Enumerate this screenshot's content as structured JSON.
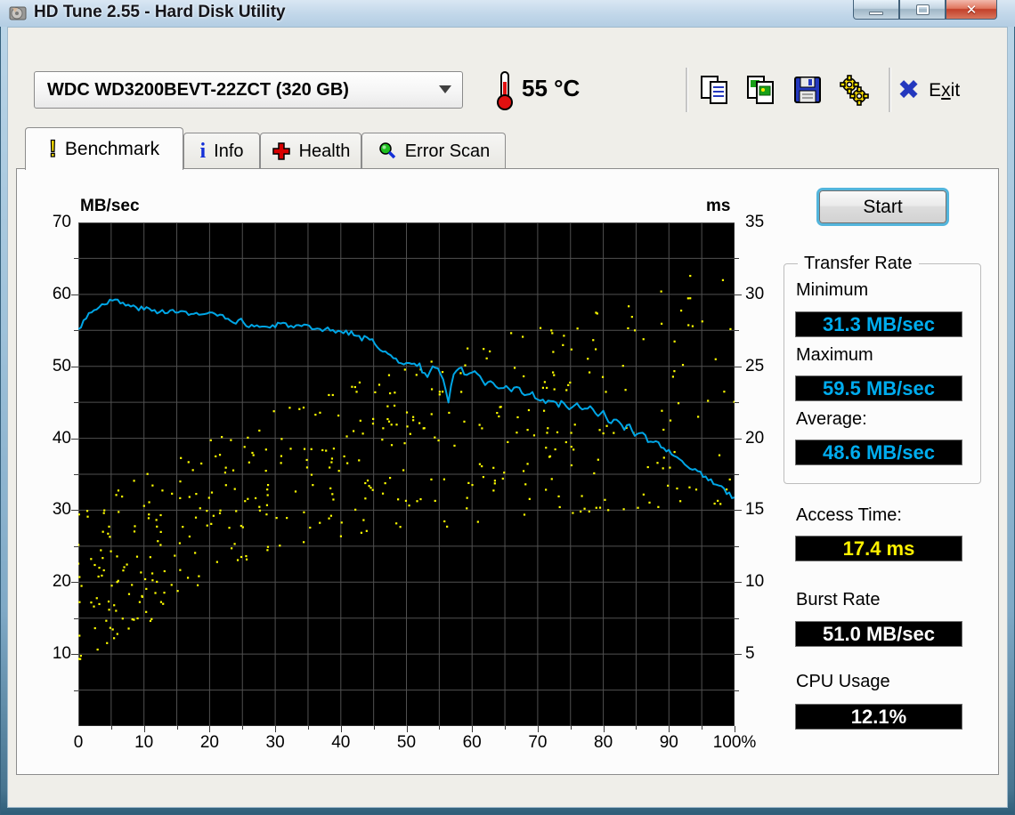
{
  "window": {
    "title": "HD Tune 2.55 - Hard Disk Utility",
    "app_icon": "hard-disk-icon",
    "controls": {
      "minimize": "minimize-button",
      "maximize": "maximize-button",
      "close": "close-button"
    }
  },
  "toolbar": {
    "drive_select": {
      "value": "WDC WD3200BEVT-22ZCT (320 GB)",
      "icon": "chevron-down-icon"
    },
    "temperature": {
      "icon": "thermometer-icon",
      "value": "55 °C"
    },
    "buttons": [
      {
        "name": "copy-text-button",
        "icon": "copy-text-icon"
      },
      {
        "name": "copy-image-button",
        "icon": "copy-image-icon"
      },
      {
        "name": "save-button",
        "icon": "save-floppy-icon"
      },
      {
        "name": "options-button",
        "icon": "gears-icon"
      }
    ],
    "exit": {
      "icon": "exit-x-icon",
      "label_pre": "E",
      "label_key": "x",
      "label_post": "it"
    }
  },
  "tabs": [
    {
      "label": "Benchmark",
      "icon": "benchmark-exclamation-icon",
      "active": true
    },
    {
      "label": "Info",
      "icon": "info-icon",
      "active": false
    },
    {
      "label": "Health",
      "icon": "health-cross-icon",
      "active": false
    },
    {
      "label": "Error Scan",
      "icon": "error-scan-magnifier-icon",
      "active": false
    }
  ],
  "benchmark": {
    "start_button": "Start",
    "transfer_rate": {
      "legend": "Transfer Rate",
      "minimum_label": "Minimum",
      "minimum_value": "31.3 MB/sec",
      "maximum_label": "Maximum",
      "maximum_value": "59.5 MB/sec",
      "average_label": "Average:",
      "average_value": "48.6 MB/sec"
    },
    "access_time_label": "Access Time:",
    "access_time_value": "17.4 ms",
    "burst_rate_label": "Burst Rate",
    "burst_rate_value": "51.0 MB/sec",
    "cpu_usage_label": "CPU Usage",
    "cpu_usage_value": "12.1%"
  },
  "colors": {
    "chart_bg": "#000000",
    "grid": "#505050",
    "line": "#00A6E6",
    "dots": "#FFFF00",
    "value_cyan": "#00ACEE",
    "value_yellow": "#FFF200",
    "value_white": "#FFFFFF"
  },
  "chart_data": {
    "type": "line",
    "title": "",
    "xlabel_ticks": [
      "0",
      "10",
      "20",
      "30",
      "40",
      "50",
      "60",
      "70",
      "80",
      "90",
      "100%"
    ],
    "x_axis": {
      "min": 0,
      "max": 100,
      "ticks": [
        0,
        10,
        20,
        30,
        40,
        50,
        60,
        70,
        80,
        90,
        100
      ],
      "minor_step": 5
    },
    "y_left": {
      "label": "MB/sec",
      "min": 0,
      "max": 70,
      "ticks": [
        70,
        60,
        50,
        40,
        30,
        20,
        10
      ],
      "minor_step": 5
    },
    "y_right": {
      "label": "ms",
      "min": 0,
      "max": 35,
      "ticks": [
        35,
        30,
        25,
        20,
        15,
        10,
        5
      ],
      "minor_step": 2.5
    },
    "grid": true,
    "legend_position": "none",
    "series": [
      {
        "name": "Transfer Rate (MB/sec)",
        "type": "line",
        "axis": "left",
        "keypoints": [
          [
            0,
            55
          ],
          [
            1,
            56.8
          ],
          [
            2,
            57.5
          ],
          [
            3,
            58.3
          ],
          [
            4,
            58.8
          ],
          [
            5,
            59.2
          ],
          [
            6,
            59
          ],
          [
            8,
            58.3
          ],
          [
            10,
            58
          ],
          [
            12,
            57.6
          ],
          [
            14,
            57.8
          ],
          [
            15,
            57.3
          ],
          [
            16,
            57.6
          ],
          [
            18,
            57.2
          ],
          [
            20,
            57.3
          ],
          [
            22,
            57
          ],
          [
            23,
            56.1
          ],
          [
            24,
            55.8
          ],
          [
            25,
            56.6
          ],
          [
            26,
            55.4
          ],
          [
            27,
            55.7
          ],
          [
            29,
            55.4
          ],
          [
            31,
            55.9
          ],
          [
            33,
            55.6
          ],
          [
            35,
            55.4
          ],
          [
            36,
            54.9
          ],
          [
            38,
            55.1
          ],
          [
            40,
            54.8
          ],
          [
            42,
            54.6
          ],
          [
            43,
            53.8
          ],
          [
            44,
            54.3
          ],
          [
            45,
            53.2
          ],
          [
            46,
            52.6
          ],
          [
            47,
            51.8
          ],
          [
            48,
            51
          ],
          [
            50,
            50.4
          ],
          [
            52,
            50.1
          ],
          [
            53,
            48.4
          ],
          [
            54,
            50
          ],
          [
            55,
            49.6
          ],
          [
            56,
            47
          ],
          [
            56.5,
            44.5
          ],
          [
            57,
            48.8
          ],
          [
            58,
            49.8
          ],
          [
            59,
            49
          ],
          [
            60,
            49.4
          ],
          [
            61,
            48.6
          ],
          [
            62,
            47.7
          ],
          [
            63,
            48.2
          ],
          [
            64,
            47
          ],
          [
            65,
            47.4
          ],
          [
            66,
            46.6
          ],
          [
            67,
            46.9
          ],
          [
            68,
            46.1
          ],
          [
            69,
            46.4
          ],
          [
            70,
            45.6
          ],
          [
            71,
            44.9
          ],
          [
            72,
            45.4
          ],
          [
            73,
            44.6
          ],
          [
            74,
            45
          ],
          [
            75,
            44.2
          ],
          [
            76,
            44.6
          ],
          [
            77,
            43.8
          ],
          [
            78,
            44.2
          ],
          [
            79,
            43.2
          ],
          [
            80,
            43.5
          ],
          [
            81,
            42.2
          ],
          [
            82,
            42.8
          ],
          [
            83,
            41.3
          ],
          [
            84,
            41.8
          ],
          [
            85,
            40.2
          ],
          [
            86,
            40.8
          ],
          [
            87,
            39.2
          ],
          [
            88,
            39.7
          ],
          [
            89,
            38.6
          ],
          [
            90,
            38.2
          ],
          [
            91,
            37.2
          ],
          [
            92,
            36.6
          ],
          [
            93,
            36.2
          ],
          [
            94,
            35.6
          ],
          [
            95,
            34.9
          ],
          [
            96,
            34.3
          ],
          [
            97,
            33.7
          ],
          [
            98,
            33.1
          ],
          [
            99,
            32.4
          ],
          [
            100,
            31.5
          ]
        ],
        "jitter": 0.35,
        "step": 0.4,
        "seed": 3
      },
      {
        "name": "Access Time (ms)",
        "type": "scatter",
        "axis": "right",
        "seed": 7,
        "count": 440,
        "x_bias": 1.25,
        "low_bias": 1.3,
        "dot_size": 2.2,
        "envelope_x": [
          0,
          10,
          20,
          30,
          40,
          50,
          60,
          70,
          80,
          90,
          100
        ],
        "lower_ms": [
          4.5,
          7,
          10,
          12.5,
          13,
          13.5,
          14,
          14.5,
          15,
          15,
          15
        ],
        "upper_ms": [
          15,
          17.5,
          20,
          22,
          24,
          25,
          26.5,
          28,
          29.5,
          31,
          32
        ]
      }
    ],
    "summary": {
      "transfer_min_mb_s": 31.3,
      "transfer_max_mb_s": 59.5,
      "transfer_avg_mb_s": 48.6,
      "access_time_ms": 17.4,
      "burst_rate_mb_s": 51.0,
      "cpu_usage_pct": 12.1
    }
  }
}
